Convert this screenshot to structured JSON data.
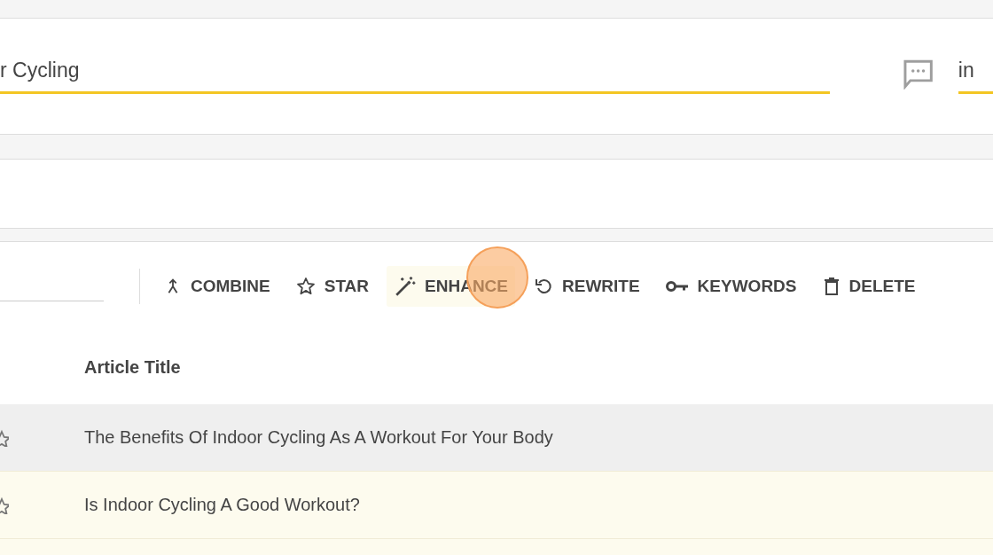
{
  "topic_field": {
    "value": "r Cycling"
  },
  "side_field": {
    "value": "in"
  },
  "toolbar": [
    {
      "label": "COMBINE",
      "kind": "combine",
      "active": false
    },
    {
      "label": "STAR",
      "kind": "star",
      "active": false
    },
    {
      "label": "ENHANCE",
      "kind": "enhance",
      "active": true
    },
    {
      "label": "REWRITE",
      "kind": "rewrite",
      "active": false
    },
    {
      "label": "KEYWORDS",
      "kind": "keywords",
      "active": false
    },
    {
      "label": "DELETE",
      "kind": "delete",
      "active": false
    }
  ],
  "table": {
    "columns": [
      "Article Title"
    ],
    "rows": [
      {
        "title": "The Benefits Of Indoor Cycling As A Workout For Your Body",
        "hovered": true,
        "selected": false
      },
      {
        "title": "Is Indoor Cycling A Good Workout?",
        "hovered": false,
        "selected": true
      },
      {
        "hovered": false,
        "selected": true
      }
    ]
  }
}
